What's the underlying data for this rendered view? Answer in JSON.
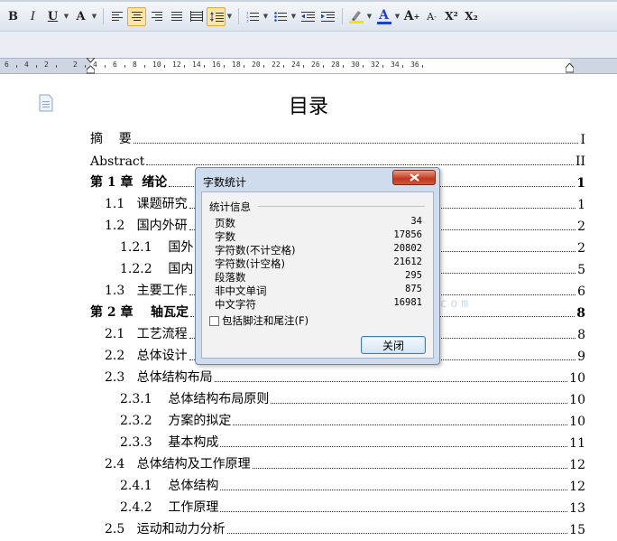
{
  "toolbar": {
    "bold": "B",
    "italic": "I",
    "underline": "U",
    "font_size_up": "A",
    "font_grow": "A",
    "font_shrink": "A",
    "superscript": "X²",
    "subscript": "X₂",
    "highlight_color": "#f6e400",
    "font_color": "#1d3fd6"
  },
  "ruler": {
    "numbers": [
      "6",
      "4",
      "2",
      "2",
      "4",
      "6",
      "8",
      "10",
      "12",
      "14",
      "16",
      "18",
      "20",
      "22",
      "24",
      "26",
      "28",
      "30",
      "32",
      "34",
      "36"
    ]
  },
  "document": {
    "title": "目录",
    "toc": [
      {
        "label": "摘    要",
        "page": "I"
      },
      {
        "label": "Abstract",
        "page": "II"
      },
      {
        "label": "第 1 章  绪论",
        "page": "1"
      },
      {
        "label": "1.1   课题研究",
        "page": "1"
      },
      {
        "label": "1.2   国内外研",
        "page": "2"
      },
      {
        "label": "1.2.1    国外",
        "page": "2"
      },
      {
        "label": "1.2.2    国内",
        "page": "5"
      },
      {
        "label": "1.3   主要工作",
        "page": "6"
      },
      {
        "label": "第 2 章    轴瓦定",
        "page": "8"
      },
      {
        "label": "2.1   工艺流程",
        "page": "8"
      },
      {
        "label": "2.2   总体设计",
        "page": "9"
      },
      {
        "label": "2.3   总体结构布局",
        "page": "10"
      },
      {
        "label": "2.3.1    总体结构布局原则",
        "page": "10"
      },
      {
        "label": "2.3.2    方案的拟定",
        "page": "10"
      },
      {
        "label": "2.3.3    基本构成",
        "page": "11"
      },
      {
        "label": "2.4   总体结构及工作原理",
        "page": "12"
      },
      {
        "label": "2.4.1    总体结构",
        "page": "12"
      },
      {
        "label": "2.4.2    工作原理",
        "page": "13"
      },
      {
        "label": "2.5   运动和动力分析",
        "page": "15"
      }
    ]
  },
  "dialog": {
    "title": "字数统计",
    "group_label": "统计信息",
    "stats": [
      {
        "label": "页数",
        "value": "34"
      },
      {
        "label": "字数",
        "value": "17856"
      },
      {
        "label": "字符数(不计空格)",
        "value": "20802"
      },
      {
        "label": "字符数(计空格)",
        "value": "21612"
      },
      {
        "label": "段落数",
        "value": "295"
      },
      {
        "label": "非中文单词",
        "value": "875"
      },
      {
        "label": "中文字符",
        "value": "16981"
      }
    ],
    "checkbox_label": "包括脚注和尾注(F)",
    "checkbox_checked": false,
    "close_button": "关闭"
  },
  "watermark": {
    "text": "文",
    "url_text": "www.renrendoc.com"
  }
}
